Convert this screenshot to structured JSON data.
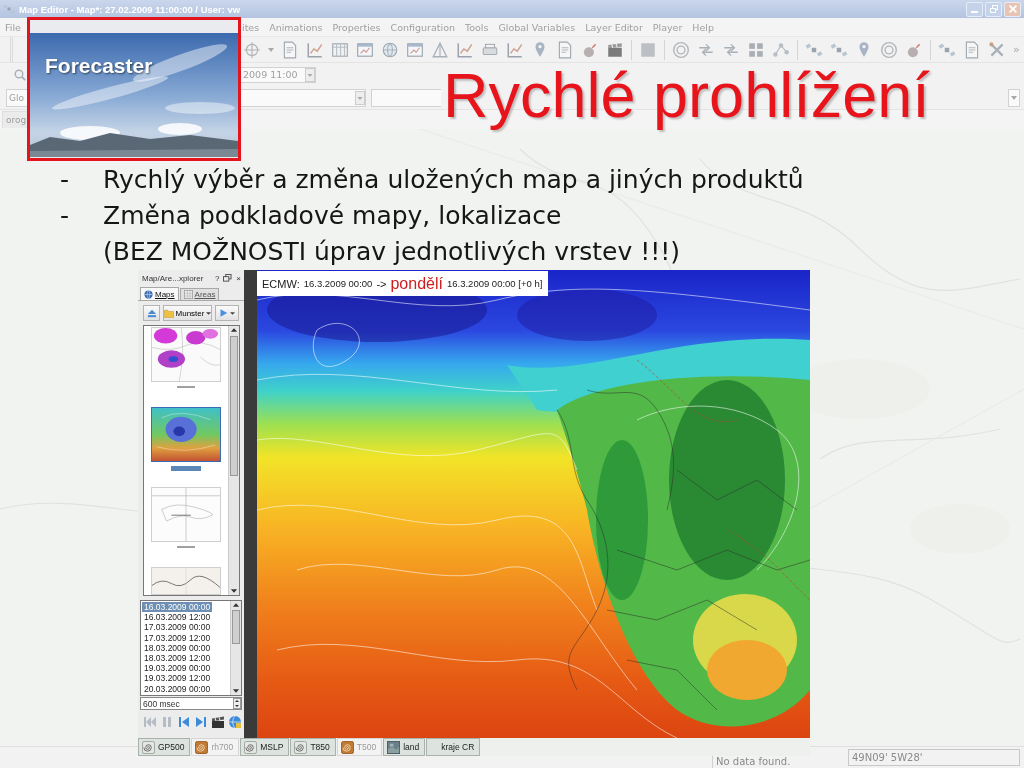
{
  "window": {
    "title": "Map Editor - Map*: 27.02.2009 11:00:00 / User: vw"
  },
  "menu": [
    "File",
    "ites",
    "Animations",
    "Properties",
    "Configuration",
    "Tools",
    "Global Variables",
    "Layer Editor",
    "Player",
    "Help"
  ],
  "toolbar": {
    "overflow": "»",
    "time_combo": "2009 11:00",
    "global_field": "Glo",
    "tab": "orog"
  },
  "slide": {
    "logo": {
      "text": "Forecaster"
    },
    "title": "Rychlé prohlížení",
    "bullets": [
      {
        "marker": "-",
        "text": "Rychlý výběr a změna uložených map a jiných produktů"
      },
      {
        "marker": "-",
        "text": "Změna podkladové mapy, lokalizace",
        "note": "(BEZ MOŽNOSTI úprav jednotlivých vrstev !!!)"
      }
    ]
  },
  "explorer": {
    "title": "Map/Are...xplorer",
    "help": "?",
    "close": "×",
    "tabs": [
      {
        "label": "Maps",
        "selected": true
      },
      {
        "label": "Areas",
        "selected": false
      }
    ],
    "folder": "Munster",
    "thumbnails": [
      {
        "kind": "radar",
        "selected": false
      },
      {
        "kind": "model",
        "selected": true
      },
      {
        "kind": "outline",
        "selected": false
      },
      {
        "kind": "terrain",
        "selected": false
      }
    ],
    "times": [
      {
        "label": "16.03.2009 00:00",
        "selected": true
      },
      {
        "label": "16.03.2009 12:00",
        "selected": false
      },
      {
        "label": "17.03.2009 00:00",
        "selected": false
      },
      {
        "label": "17.03.2009 12:00",
        "selected": false
      },
      {
        "label": "18.03.2009 00:00",
        "selected": false
      },
      {
        "label": "18.03.2009 12:00",
        "selected": false
      },
      {
        "label": "19.03.2009 00:00",
        "selected": false
      },
      {
        "label": "19.03.2009 12:00",
        "selected": false
      },
      {
        "label": "20.03.2009 00:00",
        "selected": false
      }
    ],
    "interval": "600 msec",
    "player": [
      {
        "kind": "first",
        "disabled": true
      },
      {
        "kind": "pause",
        "disabled": true
      },
      {
        "kind": "previous",
        "disabled": false
      },
      {
        "kind": "next",
        "disabled": false
      },
      {
        "kind": "movie",
        "disabled": false
      },
      {
        "kind": "globe",
        "disabled": false
      }
    ]
  },
  "map": {
    "header": {
      "model": "ECMW:",
      "run": "16.3.2009 00:00",
      "arrow": "->",
      "day": "pondělí",
      "valid": "16.3.2009 00:00 [+0 h]"
    }
  },
  "layers": [
    {
      "label": "GP500",
      "kind": "contour",
      "active": true
    },
    {
      "label": "rh700",
      "kind": "shaded",
      "active": false
    },
    {
      "label": "MSLP",
      "kind": "contour",
      "active": true
    },
    {
      "label": "T850",
      "kind": "contour",
      "active": true
    },
    {
      "label": "T500",
      "kind": "shaded",
      "active": false
    },
    {
      "label": "land",
      "kind": "land",
      "active": true
    },
    {
      "label": "kraje CR",
      "kind": "plain",
      "active": true
    }
  ],
  "status_bar": {
    "message": "No data found.",
    "coordinates": "49N09' 5W28'"
  }
}
